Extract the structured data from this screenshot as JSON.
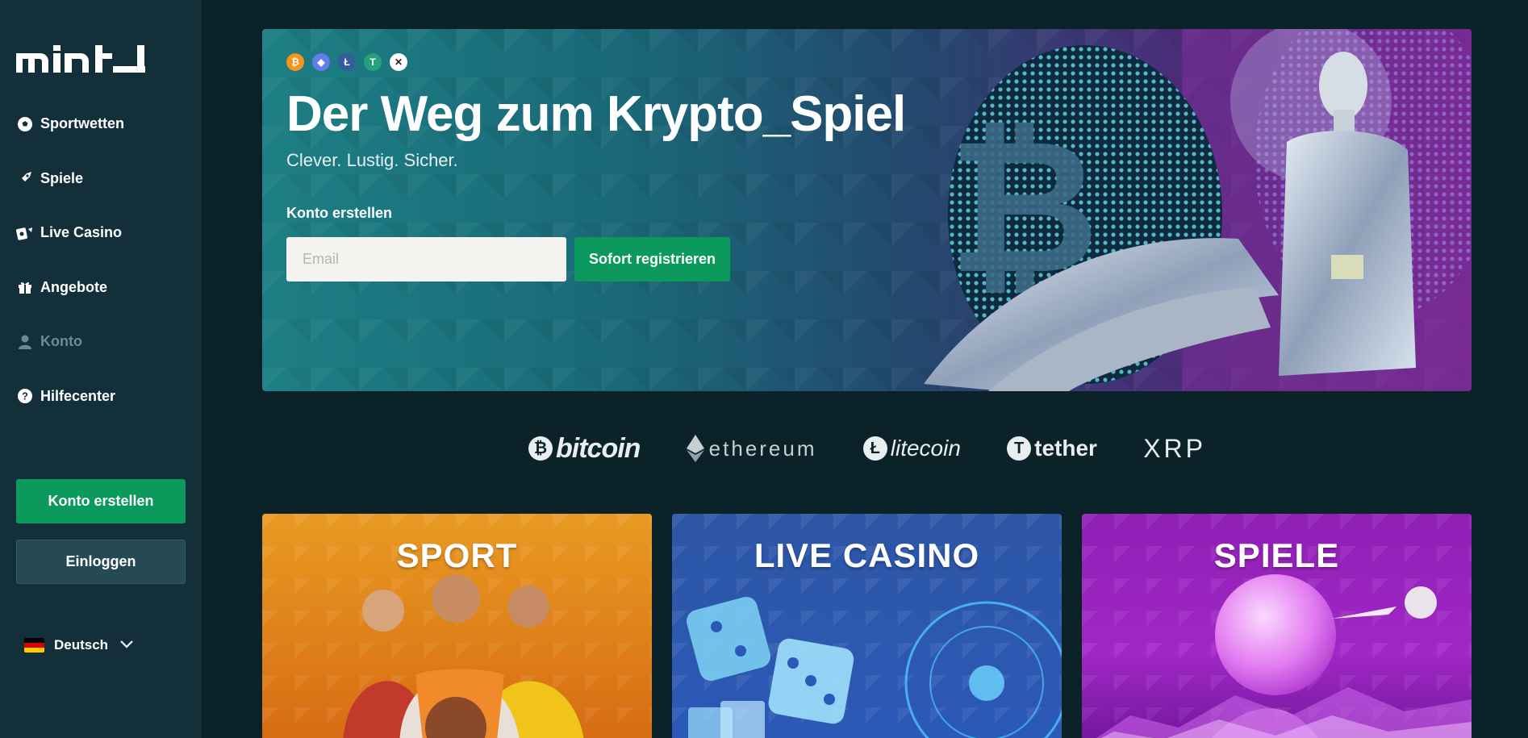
{
  "sidebar": {
    "logo_text": "mint",
    "items": [
      {
        "label": "Sportwetten",
        "icon": "soccer-ball-icon"
      },
      {
        "label": "Spiele",
        "icon": "rocket-icon"
      },
      {
        "label": "Live Casino",
        "icon": "casino-chip-icon"
      },
      {
        "label": "Angebote",
        "icon": "gift-icon"
      },
      {
        "label": "Konto",
        "icon": "user-icon"
      },
      {
        "label": "Hilfecenter",
        "icon": "help-icon"
      }
    ],
    "create_account_label": "Konto erstellen",
    "login_label": "Einloggen",
    "language": "Deutsch"
  },
  "hero": {
    "coins": [
      "bitcoin-icon",
      "ethereum-icon",
      "litecoin-icon",
      "tether-icon",
      "xrp-icon"
    ],
    "title": "Der Weg zum Krypto_Spiel",
    "subtitle": "Clever. Lustig. Sicher.",
    "form_label": "Konto erstellen",
    "email_placeholder": "Email",
    "register_label": "Sofort registrieren"
  },
  "crypto_strip": {
    "bitcoin": "bitcoin",
    "ethereum": "ethereum",
    "litecoin": "litecoin",
    "tether": "tether",
    "xrp": "XRP"
  },
  "categories": [
    {
      "title": "SPORT"
    },
    {
      "title": "LIVE CASINO"
    },
    {
      "title": "SPIELE"
    }
  ],
  "colors": {
    "background": "#0b2228",
    "sidebar": "#13303a",
    "accent_green": "#0b9a5c",
    "sport_orange": "#e99a22",
    "casino_blue": "#2d56a6",
    "games_purple": "#9a22c0"
  }
}
